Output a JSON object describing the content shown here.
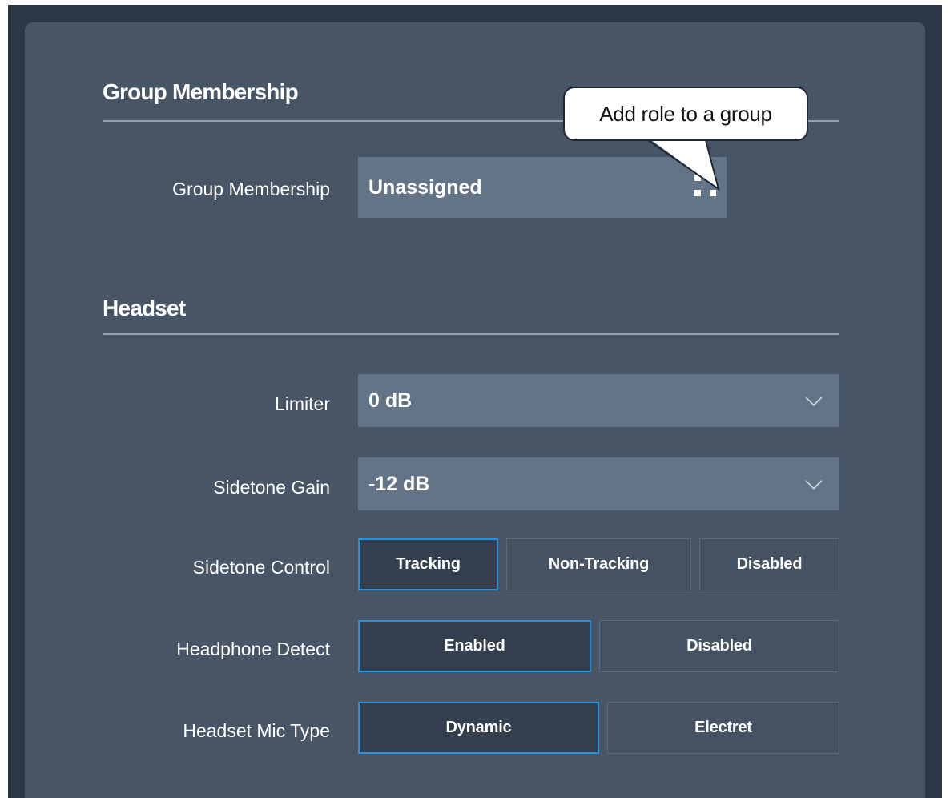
{
  "group_section": {
    "title": "Group Membership",
    "field_label": "Group Membership",
    "field_value": "Unassigned",
    "action_icon": "grid-icon",
    "tooltip": "Add role to a group"
  },
  "headset_section": {
    "title": "Headset",
    "limiter": {
      "label": "Limiter",
      "value": "0 dB",
      "icon": "chevron-down-icon"
    },
    "sidetone_gain": {
      "label": "Sidetone Gain",
      "value": "-12 dB",
      "icon": "chevron-down-icon"
    },
    "sidetone_control": {
      "label": "Sidetone Control",
      "options": [
        "Tracking",
        "Non-Tracking",
        "Disabled"
      ],
      "selected": "Tracking"
    },
    "headphone_detect": {
      "label": "Headphone Detect",
      "options": [
        "Enabled",
        "Disabled"
      ],
      "selected": "Enabled"
    },
    "headset_mic_type": {
      "label": "Headset Mic Type",
      "options": [
        "Dynamic",
        "Electret"
      ],
      "selected": "Dynamic"
    }
  },
  "colors": {
    "background": "#2d3846",
    "panel": "#475566",
    "field": "#647487",
    "selected_segment": "#333f4f",
    "accent": "#2892da",
    "text": "#ffffff"
  }
}
